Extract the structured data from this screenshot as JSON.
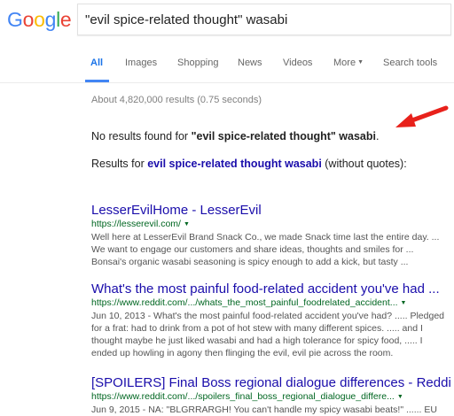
{
  "logo": {
    "text": "Google"
  },
  "search": {
    "query": "\"evil spice-related thought\" wasabi"
  },
  "tabs": [
    "All",
    "Images",
    "Shopping",
    "News",
    "Videos",
    "More",
    "Search tools"
  ],
  "stats": "About 4,820,000 results (0.75 seconds)",
  "notice": {
    "prefix": "No results found for ",
    "quoted": "\"evil spice-related thought\" wasabi",
    "suffix": ".",
    "results_for": "Results for ",
    "link": "evil spice-related thought wasabi",
    "without": " (without quotes):"
  },
  "results": [
    {
      "title": "LesserEvilHome - LesserEvil",
      "url": "https://lesserevil.com/",
      "snippet": [
        "Well here at LesserEvil Brand Snack Co., we made Snack time last the entire day. ...",
        "We want to engage our customers and share ideas, thoughts and smiles for ...",
        "Bonsai's organic wasabi seasoning is spicy enough to add a kick, but tasty ..."
      ]
    },
    {
      "title": "What's the most painful food-related accident you've had ...",
      "url": "https://www.reddit.com/.../whats_the_most_painful_foodrelated_accident...",
      "snippet": [
        "Jun 10, 2013 - What's the most painful food-related accident you've had? ..... Pledged",
        "for a frat: had to drink from a pot of hot stew with many different spices. ..... and I",
        "thought maybe he just liked wasabi and had a high tolerance for spicy food, ..... I",
        "ended up howling in agony then flinging the evil, evil pie across the room."
      ]
    },
    {
      "title": "[SPOILERS] Final Boss regional dialogue differences - Reddit",
      "url": "https://www.reddit.com/.../spoilers_final_boss_regional_dialogue_differe...",
      "snippet": [
        "Jun 9, 2015 - NA: \"BLGRRARGH! You can't handle my spicy wasabi beats!\" ...... EU"
      ]
    }
  ],
  "colors": {
    "link": "#1a0dab",
    "url": "#006621",
    "active_tab": "#1a73e8",
    "arrow": "#e8211b"
  }
}
